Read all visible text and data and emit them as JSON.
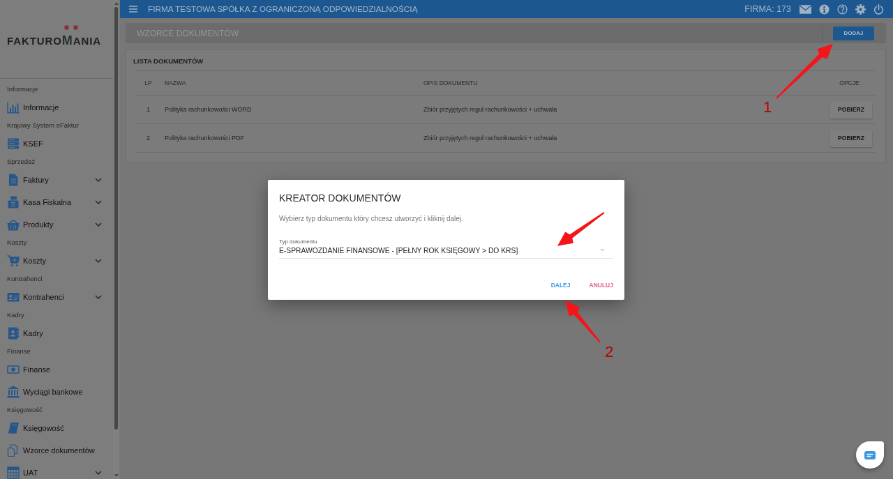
{
  "sidebar": {
    "logo": {
      "before": "FAKTURO",
      "accent": "M",
      "after": "ANIA"
    },
    "sections": [
      {
        "label": "Informacje",
        "items": [
          {
            "label": "Informacje",
            "expandable": false
          }
        ]
      },
      {
        "label": "Krajowy System eFaktur",
        "items": [
          {
            "label": "KSEF",
            "expandable": false
          }
        ]
      },
      {
        "label": "Sprzedaż",
        "items": [
          {
            "label": "Faktury",
            "expandable": true
          },
          {
            "label": "Kasa Fiskalna",
            "expandable": true
          },
          {
            "label": "Produkty",
            "expandable": true
          }
        ]
      },
      {
        "label": "Koszty",
        "items": [
          {
            "label": "Koszty",
            "expandable": true
          }
        ]
      },
      {
        "label": "Kontrahenci",
        "items": [
          {
            "label": "Kontrahenci",
            "expandable": true
          }
        ]
      },
      {
        "label": "Kadry",
        "items": [
          {
            "label": "Kadry",
            "expandable": false
          }
        ]
      },
      {
        "label": "Finanse",
        "items": [
          {
            "label": "Finanse",
            "expandable": false
          },
          {
            "label": "Wyciągi bankowe",
            "expandable": false
          }
        ]
      },
      {
        "label": "Księgowość",
        "items": [
          {
            "label": "Księgowość",
            "expandable": false
          },
          {
            "label": "Wzorce dokumentów",
            "expandable": false
          },
          {
            "label": "UAT",
            "expandable": true
          }
        ]
      }
    ]
  },
  "header": {
    "title": "FIRMA TESTOWA SPÓŁKA Z OGRANICZONĄ ODPOWIEDZIALNOŚCIĄ",
    "company": "FIRMA: 173"
  },
  "toolbar": {
    "title": "WZORCE DOKUMENTÓW",
    "add_button": "DODAJ"
  },
  "documents": {
    "title": "LISTA DOKUMENTÓW",
    "columns": [
      "LP",
      "NAZWA",
      "OPIS DOKUMENTU",
      "OPCJE"
    ],
    "rows": [
      {
        "lp": "1",
        "name": "Polityka rachunkowości WORD",
        "description": "Zbiór przyjętych reguł rachunkowości + uchwała",
        "action": "POBIERZ"
      },
      {
        "lp": "2",
        "name": "Polityka rachunkowości PDF",
        "description": "Zbiór przyjętych reguł rachunkowości + uchwała",
        "action": "POBIERZ"
      }
    ]
  },
  "dialog": {
    "title": "KREATOR DOKUMENTÓW",
    "message": "Wybierz typ dokumentu który chcesz utworzyć i kliknij dalej.",
    "field": {
      "label": "Typ dokumentu",
      "value": "E-SPRAWOZDANIE FINANSOWE - [PEŁNY ROK KSIĘGOWY > DO KRS]"
    },
    "buttons": [
      {
        "label": "DALEJ",
        "kind": "primary"
      },
      {
        "label": "ANULUJ",
        "kind": "cancel"
      }
    ]
  },
  "annotations": [
    {
      "kind": "numbered-arrow",
      "label": "1"
    },
    {
      "kind": "arrow"
    },
    {
      "kind": "numbered-arrow",
      "label": "2"
    }
  ]
}
